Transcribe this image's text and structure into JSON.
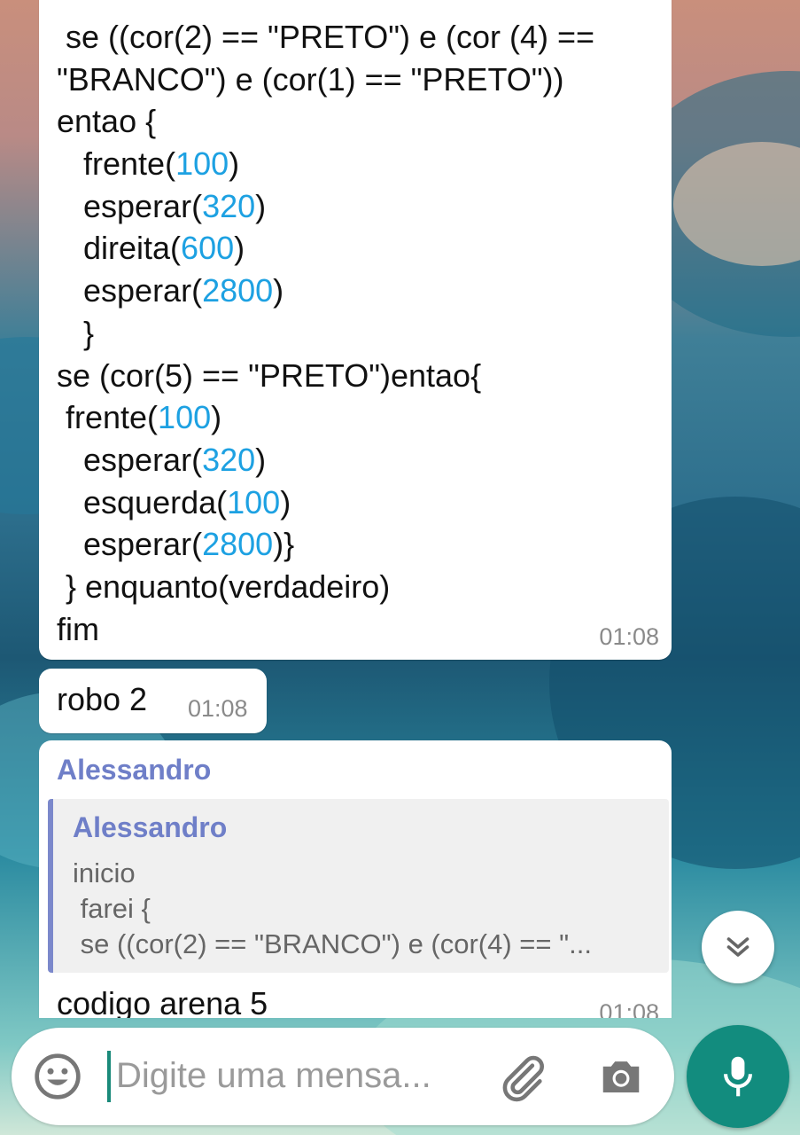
{
  "messages": [
    {
      "type": "code",
      "lines": [
        [
          {
            "t": " se ((cor(2) == \"PRETO\") e (cor (4) =="
          }
        ],
        [
          {
            "t": "\"BRANCO\") e (cor(1) == \"PRETO\"))"
          }
        ],
        [
          {
            "t": "entao {"
          }
        ],
        [
          {
            "t": "   frente("
          },
          {
            "t": "100",
            "n": true
          },
          {
            "t": ")"
          }
        ],
        [
          {
            "t": "   esperar("
          },
          {
            "t": "320",
            "n": true
          },
          {
            "t": ")"
          }
        ],
        [
          {
            "t": "   direita("
          },
          {
            "t": "600",
            "n": true
          },
          {
            "t": ")"
          }
        ],
        [
          {
            "t": "   esperar("
          },
          {
            "t": "2800",
            "n": true
          },
          {
            "t": ")"
          }
        ],
        [
          {
            "t": "   }"
          }
        ],
        [
          {
            "t": "se (cor(5) == \"PRETO\")entao{"
          }
        ],
        [
          {
            "t": " frente("
          },
          {
            "t": "100",
            "n": true
          },
          {
            "t": ")"
          }
        ],
        [
          {
            "t": "   esperar("
          },
          {
            "t": "320",
            "n": true
          },
          {
            "t": ")"
          }
        ],
        [
          {
            "t": "   esquerda("
          },
          {
            "t": "100",
            "n": true
          },
          {
            "t": ")"
          }
        ],
        [
          {
            "t": "   esperar("
          },
          {
            "t": "2800",
            "n": true
          },
          {
            "t": ")}"
          }
        ],
        [
          {
            "t": " } enquanto(verdadeiro)"
          }
        ],
        [
          {
            "t": "fim"
          }
        ]
      ],
      "time": "01:08"
    },
    {
      "type": "text",
      "text": "robo 2",
      "time": "01:08"
    },
    {
      "type": "reply",
      "sender": "Alessandro",
      "quoted_sender": "Alessandro",
      "quoted_lines": [
        "inicio",
        " farei {",
        " se ((cor(2) == \"BRANCO\") e (cor(4) == \"..."
      ],
      "text": "codigo arena 5",
      "time": "01:08"
    }
  ],
  "composer": {
    "placeholder": "Digite uma mensa..."
  },
  "icons": {
    "emoji": "emoji-icon",
    "attach": "paperclip-icon",
    "camera": "camera-icon",
    "mic": "microphone-icon",
    "scroll_down": "double-chevron-down-icon"
  },
  "colors": {
    "accent": "#128c7e",
    "number": "#1da1e2",
    "sender": "#6f7fc8"
  }
}
